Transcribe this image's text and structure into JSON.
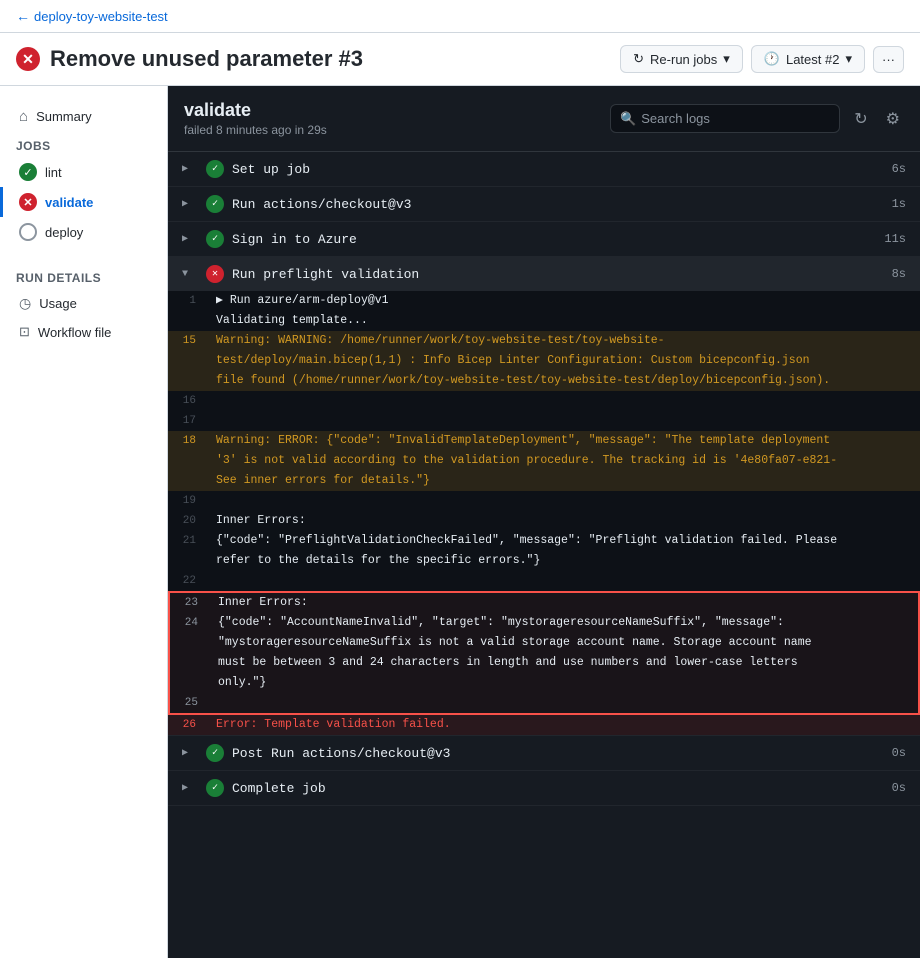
{
  "breadcrumb": {
    "back_text": "deploy-toy-website-test"
  },
  "header": {
    "title": "Remove unused parameter #3",
    "rerun_label": "Re-run jobs",
    "latest_label": "Latest #2",
    "dots_label": "···"
  },
  "sidebar": {
    "summary_label": "Summary",
    "jobs_label": "Jobs",
    "items": [
      {
        "id": "lint",
        "label": "lint",
        "status": "green"
      },
      {
        "id": "validate",
        "label": "validate",
        "status": "red",
        "active": true
      },
      {
        "id": "deploy",
        "label": "deploy",
        "status": "gray"
      }
    ],
    "run_details_label": "Run details",
    "run_items": [
      {
        "id": "usage",
        "label": "Usage"
      },
      {
        "id": "workflow-file",
        "label": "Workflow file"
      }
    ]
  },
  "log": {
    "title": "validate",
    "subtitle": "failed 8 minutes ago in 29s",
    "search_placeholder": "Search logs",
    "steps": [
      {
        "id": "setup",
        "name": "Set up job",
        "status": "green",
        "duration": "6s",
        "expanded": false
      },
      {
        "id": "checkout",
        "name": "Run actions/checkout@v3",
        "status": "green",
        "duration": "1s",
        "expanded": false
      },
      {
        "id": "signin",
        "name": "Sign in to Azure",
        "status": "green",
        "duration": "11s",
        "expanded": false
      },
      {
        "id": "preflight",
        "name": "Run preflight validation",
        "status": "red",
        "duration": "8s",
        "expanded": true
      },
      {
        "id": "post-checkout",
        "name": "Post Run actions/checkout@v3",
        "status": "green",
        "duration": "0s",
        "expanded": false
      },
      {
        "id": "complete",
        "name": "Complete job",
        "status": "green",
        "duration": "0s",
        "expanded": false
      }
    ],
    "log_lines": [
      {
        "num": "1",
        "content": "▶ Run azure/arm-deploy@v1",
        "type": "normal"
      },
      {
        "num": "",
        "content": "Validating template...",
        "type": "normal"
      },
      {
        "num": "15",
        "content": "Warning: WARNING: /home/runner/work/toy-website-test/toy-website-\ntest/deploy/main.bicep(1,1) : Info Bicep Linter Configuration: Custom bicepconfig.json\nfile found (/home/runner/work/toy-website-test/toy-website-test/deploy/bicepconfig.json).",
        "type": "warning"
      },
      {
        "num": "16",
        "content": "",
        "type": "normal"
      },
      {
        "num": "17",
        "content": "",
        "type": "normal"
      },
      {
        "num": "18",
        "content": "Warning: ERROR: {\"code\": \"InvalidTemplateDeployment\", \"message\": \"The template deployment\n'3' is not valid according to the validation procedure. The tracking id is '4e80fa07-e821-\nSee inner errors for details.\"}",
        "type": "warning"
      },
      {
        "num": "19",
        "content": "",
        "type": "normal"
      },
      {
        "num": "20",
        "content": "Inner Errors:",
        "type": "normal"
      },
      {
        "num": "21",
        "content": "{\"code\": \"PreflightValidationCheckFailed\", \"message\": \"Preflight validation failed. Please\nrefer to the details for the specific errors.\"}",
        "type": "normal"
      },
      {
        "num": "22",
        "content": "",
        "type": "normal"
      },
      {
        "num": "23",
        "content": "Inner Errors:",
        "type": "error-box-start"
      },
      {
        "num": "24",
        "content": "{\"code\": \"AccountNameInvalid\", \"target\": \"mystorageresourceNameSuffix\", \"message\":\n\"mystorageresourceNameSuffix is not a valid storage account name. Storage account name\nmust be between 3 and 24 characters in length and use numbers and lower-case letters\nonly.\"}",
        "type": "error-box"
      },
      {
        "num": "25",
        "content": "",
        "type": "error-box-end"
      },
      {
        "num": "26",
        "content": "Error: Template validation failed.",
        "type": "error-final"
      }
    ]
  }
}
